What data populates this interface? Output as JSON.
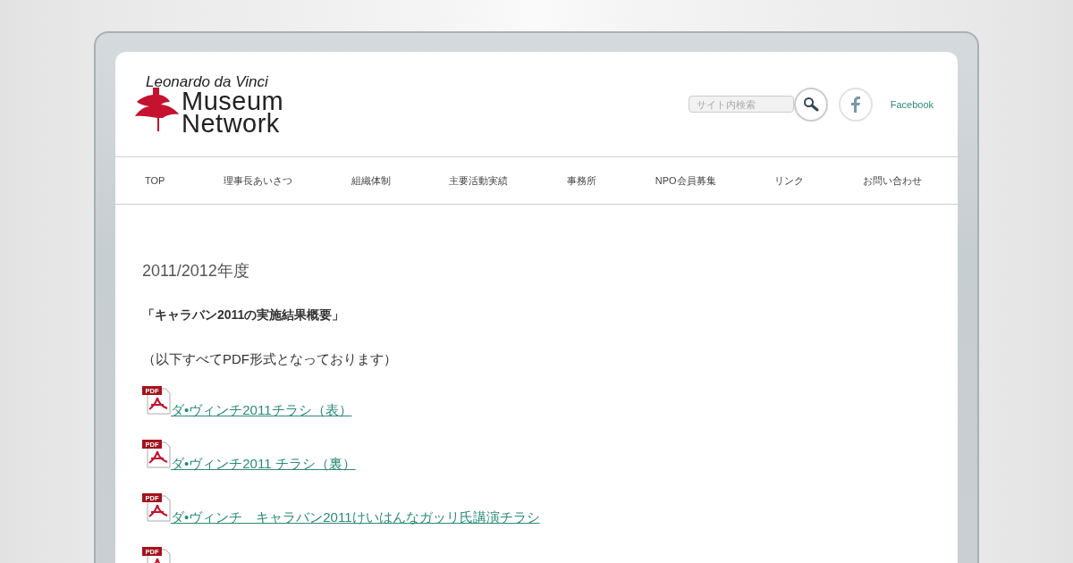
{
  "logo": {
    "line_1": "Leonardo da Vinci",
    "line_2": "Museum",
    "line_3": "Network"
  },
  "search": {
    "placeholder": "サイト内検索"
  },
  "social": {
    "label": "Facebook"
  },
  "nav": [
    {
      "label": "TOP"
    },
    {
      "label": "理事長あいさつ"
    },
    {
      "label": "組織体制"
    },
    {
      "label": "主要活動実績"
    },
    {
      "label": "事務所"
    },
    {
      "label": "NPO会員募集"
    },
    {
      "label": "リンク"
    },
    {
      "label": "お問い合わせ"
    }
  ],
  "content": {
    "heading": "2011/2012年度",
    "subheading": "「キャラバン2011の実施結果概要」",
    "note": "（以下すべてPDF形式となっております）",
    "links": [
      {
        "icon_label": "PDF",
        "text": "ダ•ヴィンチ2011チラシ（表）"
      },
      {
        "icon_label": "PDF",
        "text": "ダ•ヴィンチ2011 チラシ（裏）"
      },
      {
        "icon_label": "PDF",
        "text": "ダ•ヴィンチ　キャラバン2011けいはんなガッリ氏講演チラシ"
      },
      {
        "icon_label": "PDF"
      }
    ]
  }
}
